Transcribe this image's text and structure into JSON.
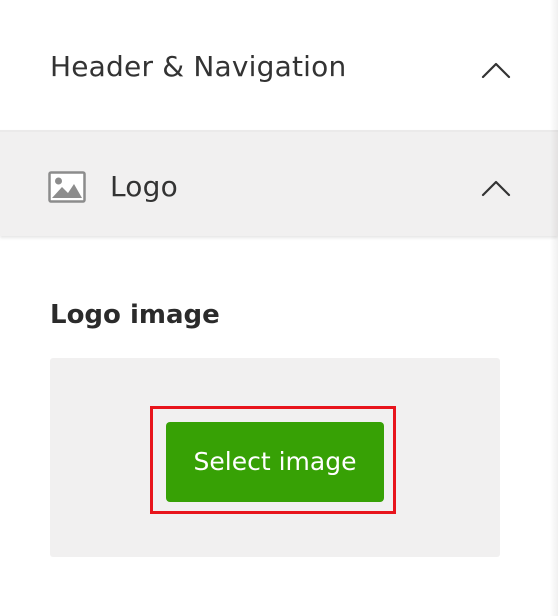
{
  "section": {
    "title": "Header & Navigation",
    "toggle_icon": "chevron-up-icon"
  },
  "subsection": {
    "icon": "image-icon",
    "title": "Logo",
    "toggle_icon": "chevron-up-icon"
  },
  "logo_field": {
    "label": "Logo image",
    "select_button_label": "Select image"
  },
  "colors": {
    "button_green": "#37a105",
    "highlight_red": "#e8141c",
    "subsection_bg": "#f1f0f0"
  }
}
